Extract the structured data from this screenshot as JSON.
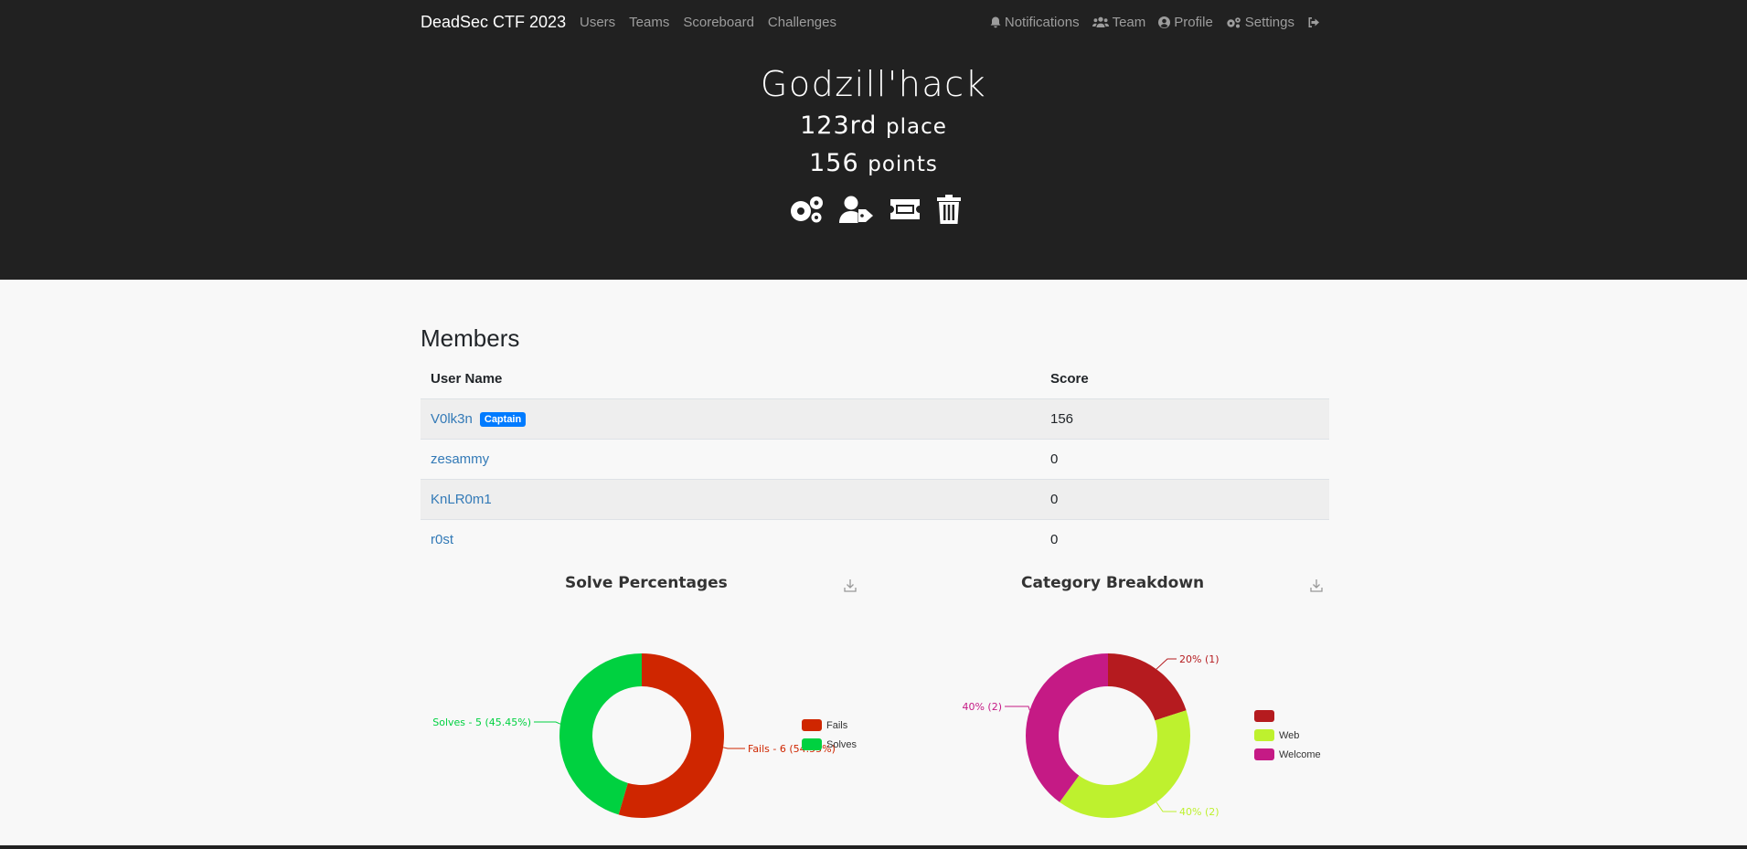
{
  "nav": {
    "brand": "DeadSec CTF 2023",
    "left": [
      "Users",
      "Teams",
      "Scoreboard",
      "Challenges"
    ],
    "notifications": "Notifications",
    "team": "Team",
    "profile": "Profile",
    "settings": "Settings"
  },
  "team": {
    "name": "Godzill'hack",
    "place_num": "123rd",
    "place_word": "place",
    "points_num": "156",
    "points_word": "points"
  },
  "members": {
    "title": "Members",
    "col_user": "User Name",
    "col_score": "Score",
    "captain_badge": "Captain",
    "rows": [
      {
        "name": "V0lk3n",
        "score": "156"
      },
      {
        "name": "zesammy",
        "score": "0"
      },
      {
        "name": "KnLR0m1",
        "score": "0"
      },
      {
        "name": "r0st",
        "score": "0"
      }
    ]
  },
  "chart_data": [
    {
      "type": "pie",
      "title": "Solve Percentages",
      "slices": [
        {
          "label": "Fails",
          "value": 6,
          "color": "#cf2600",
          "annotation": "Fails - 6 (54.55%)"
        },
        {
          "label": "Solves",
          "value": 5,
          "color": "#00d140",
          "annotation": "Solves - 5 (45.45%)"
        }
      ]
    },
    {
      "type": "pie",
      "title": "Category Breakdown",
      "slices": [
        {
          "label": "",
          "value": 1,
          "color": "#b51b1f",
          "annotation": "20% (1)"
        },
        {
          "label": "Web",
          "value": 2,
          "color": "#bef12e",
          "annotation": "40% (2)"
        },
        {
          "label": "Welcome",
          "value": 2,
          "color": "#c51a85",
          "annotation": "40% (2)"
        }
      ]
    }
  ]
}
